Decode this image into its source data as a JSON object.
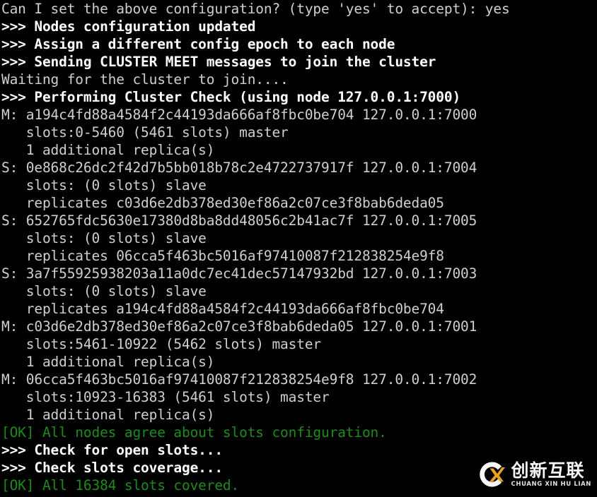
{
  "terminal": {
    "background_color": "#000000",
    "normal_color": "#cfcfcf",
    "bold_color": "#ffffff",
    "ok_color": "#1c8c1c",
    "lines": [
      {
        "text": "Can I set the above configuration? (type 'yes' to accept): yes",
        "style": "normal"
      },
      {
        "text": ">>> Nodes configuration updated",
        "style": "bold"
      },
      {
        "text": ">>> Assign a different config epoch to each node",
        "style": "bold"
      },
      {
        "text": ">>> Sending CLUSTER MEET messages to join the cluster",
        "style": "bold"
      },
      {
        "text": "Waiting for the cluster to join....",
        "style": "normal"
      },
      {
        "text": ">>> Performing Cluster Check (using node 127.0.0.1:7000)",
        "style": "bold"
      },
      {
        "text": "M: a194c4fd88a4584f2c44193da666af8fbc0be704 127.0.0.1:7000",
        "style": "normal"
      },
      {
        "text": "   slots:0-5460 (5461 slots) master",
        "style": "normal"
      },
      {
        "text": "   1 additional replica(s)",
        "style": "normal"
      },
      {
        "text": "S: 0e868c26dc2f42d7b5bb018b78c2e4722737917f 127.0.0.1:7004",
        "style": "normal"
      },
      {
        "text": "   slots: (0 slots) slave",
        "style": "normal"
      },
      {
        "text": "   replicates c03d6e2db378ed30ef86a2c07ce3f8bab6deda05",
        "style": "normal"
      },
      {
        "text": "S: 652765fdc5630e17380d8ba8dd48056c2b41ac7f 127.0.0.1:7005",
        "style": "normal"
      },
      {
        "text": "   slots: (0 slots) slave",
        "style": "normal"
      },
      {
        "text": "   replicates 06cca5f463bc5016af97410087f212838254e9f8",
        "style": "normal"
      },
      {
        "text": "S: 3a7f55925938203a11a0dc7ec41dec57147932bd 127.0.0.1:7003",
        "style": "normal"
      },
      {
        "text": "   slots: (0 slots) slave",
        "style": "normal"
      },
      {
        "text": "   replicates a194c4fd88a4584f2c44193da666af8fbc0be704",
        "style": "normal"
      },
      {
        "text": "M: c03d6e2db378ed30ef86a2c07ce3f8bab6deda05 127.0.0.1:7001",
        "style": "normal"
      },
      {
        "text": "   slots:5461-10922 (5462 slots) master",
        "style": "normal"
      },
      {
        "text": "   1 additional replica(s)",
        "style": "normal"
      },
      {
        "text": "M: 06cca5f463bc5016af97410087f212838254e9f8 127.0.0.1:7002",
        "style": "normal"
      },
      {
        "text": "   slots:10923-16383 (5461 slots) master",
        "style": "normal"
      },
      {
        "text": "   1 additional replica(s)",
        "style": "normal"
      },
      {
        "text": "[OK] All nodes agree about slots configuration.",
        "style": "green"
      },
      {
        "text": ">>> Check for open slots...",
        "style": "bold"
      },
      {
        "text": ">>> Check slots coverage...",
        "style": "bold"
      },
      {
        "text": "[OK] All 16384 slots covered.",
        "style": "green"
      }
    ]
  },
  "watermark": {
    "chinese_text": "创新互联",
    "pinyin_text": "CHUANG XIN HU LIAN",
    "mark_letter": "X",
    "ring_color": "#ffffff",
    "accent_color": "#f0a81e"
  }
}
